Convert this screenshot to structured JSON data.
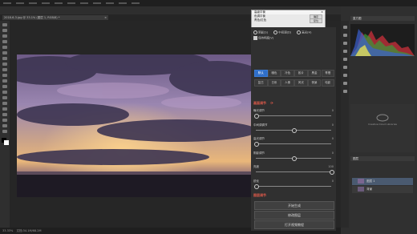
{
  "document": {
    "tab_title": "2018-6-3.jpg @ 33.1% (图层 1, RGB/8) *",
    "close_glyph": "×"
  },
  "status": {
    "zoom": "33.33%",
    "doc_info": "文档:34.1M/68.2M"
  },
  "dialog": {
    "title": "高级平衡",
    "close_glyph": "×",
    "rows": [
      {
        "label": "色调平衡",
        "button": "确定"
      },
      {
        "label": "青色/红色",
        "button": "复位"
      }
    ]
  },
  "plugin": {
    "presets": {
      "radio_a": "阴影(S)",
      "radio_b": "中间调(D)",
      "radio_c": "高光(H)",
      "checkbox": "保持明度(V)"
    },
    "style_buttons": [
      "默认",
      "暖色",
      "冷色",
      "胶片",
      "黑金",
      "青橙",
      "复古",
      "日系",
      "人像",
      "风光",
      "夜景",
      "电影"
    ],
    "section_adjust": "画面调节",
    "sliders": [
      {
        "label": "曝光调节",
        "value": "0",
        "level": 0.0
      },
      {
        "label": "中间调调节",
        "value": "0",
        "level": 0.5
      },
      {
        "label": "高光调节",
        "value": "0",
        "level": 0.0
      },
      {
        "label": "阴影调节",
        "value": "0",
        "level": 0.5
      },
      {
        "label": "亮度",
        "value": "100",
        "level": 1.0
      },
      {
        "label": "锐化",
        "value": "0",
        "level": 0.0
      }
    ],
    "section_generate": "图层调节",
    "buttons": [
      "开始生成",
      "修改图层",
      "打开视频教程"
    ]
  },
  "panels": {
    "histogram_title": "直方图",
    "cc_text": "Creative Cloud Libraries",
    "layers_title": "图层",
    "layers": [
      {
        "name": "图层 1",
        "selected": true
      },
      {
        "name": "背景",
        "selected": false
      }
    ]
  },
  "colors": {
    "accent_blue": "#2f6fc9",
    "section_red": "#e05a4a",
    "panel_bg": "#303030"
  }
}
